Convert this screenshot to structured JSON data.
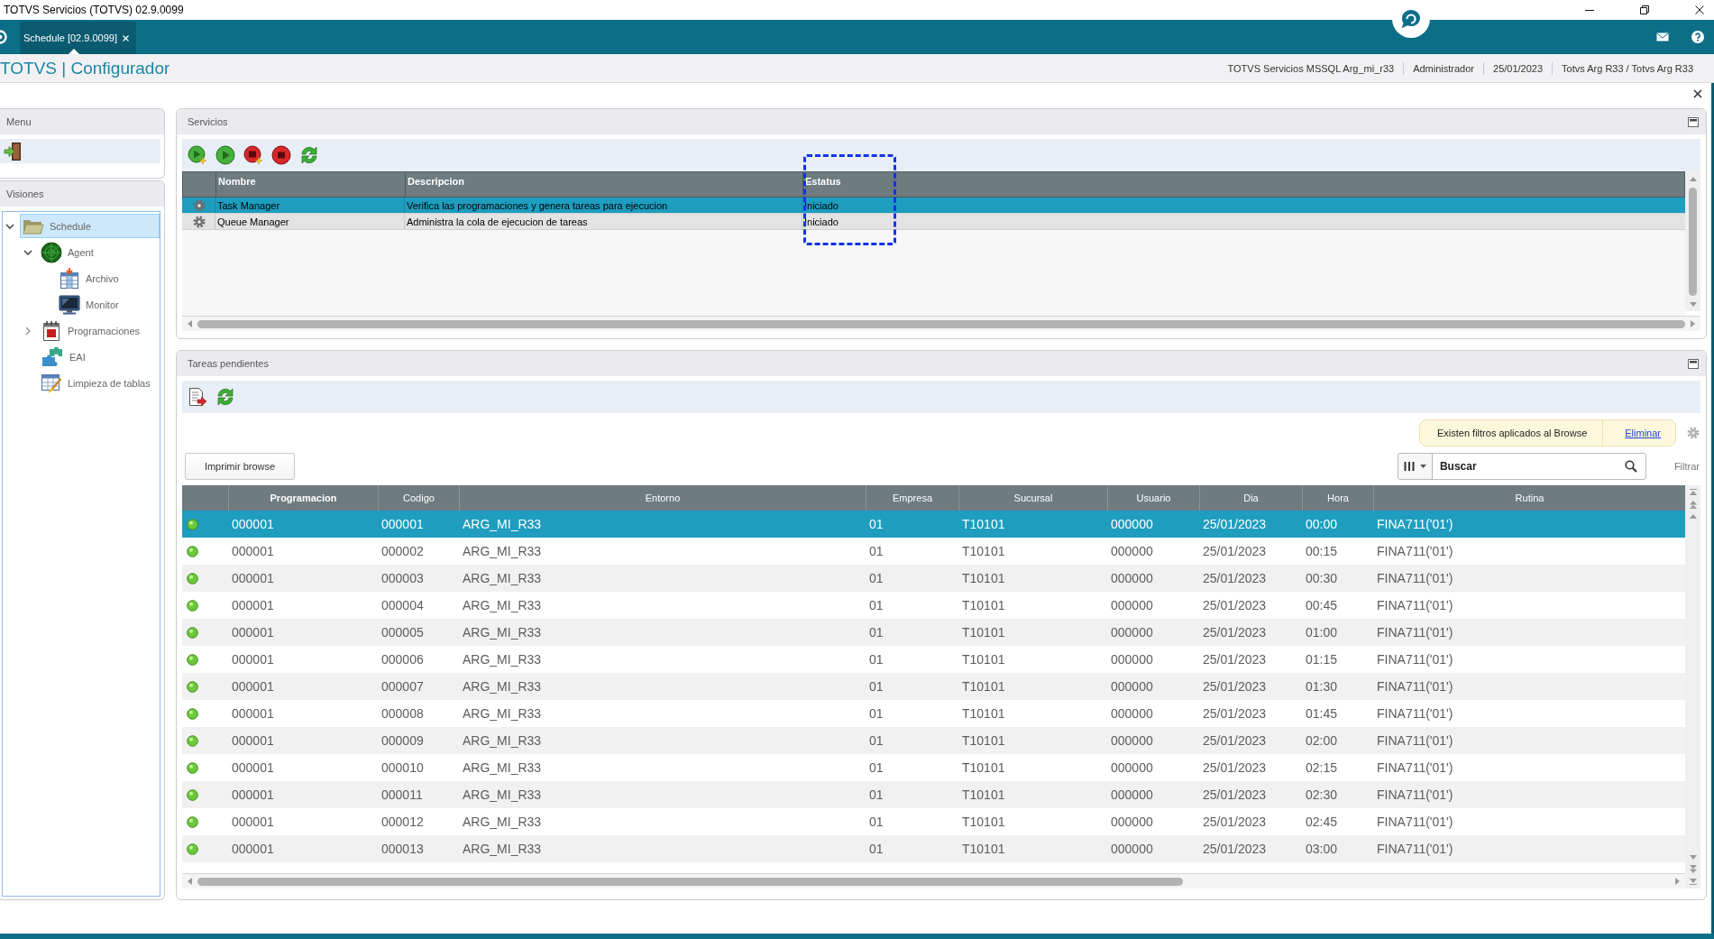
{
  "window": {
    "title": "TOTVS Servicios (TOTVS) 02.9.0099"
  },
  "tabs": [
    {
      "label": "Schedule [02.9.0099]",
      "selected": true
    }
  ],
  "header": {
    "title": "TOTVS | Configurador",
    "info": [
      "TOTVS Servicios MSSQL Arg_mi_r33",
      "Administrador",
      "25/01/2023",
      "Totvs Arg R33 / Totvs Arg R33"
    ]
  },
  "menu": {
    "title": "Menu"
  },
  "visiones": {
    "title": "Visiones",
    "tree": [
      {
        "label": "Schedule",
        "selected": true,
        "expanded": true,
        "children": [
          {
            "label": "Agent",
            "selected": false,
            "expanded": true,
            "children": [
              {
                "label": "Archivo",
                "selected": false
              },
              {
                "label": "Monitor",
                "selected": false
              }
            ]
          },
          {
            "label": "Programaciones",
            "selected": false,
            "expanded": false
          },
          {
            "label": "EAI",
            "selected": false
          },
          {
            "label": "Limpieza de tablas",
            "selected": false
          }
        ]
      }
    ]
  },
  "servicios": {
    "title": "Servicios",
    "columns": [
      {
        "label": "Nombre",
        "highlighted": false
      },
      {
        "label": "Descripcion",
        "highlighted": false
      },
      {
        "label": "Estatus",
        "highlighted": true
      }
    ],
    "rows": [
      {
        "cells": [
          "Task Manager",
          "Verifica las programaciones y genera tareas para ejecucion",
          "Iniciado"
        ],
        "selected": true
      },
      {
        "cells": [
          "Queue Manager",
          "Administra la cola de ejecucion de tareas",
          "Iniciado"
        ],
        "selected": false
      }
    ]
  },
  "tareas": {
    "title": "Tareas pendientes",
    "filter_notice": {
      "text": "Existen filtros aplicados al Browse",
      "link": "Eliminar"
    },
    "print_button": "Imprimir browse",
    "search": {
      "placeholder": "Buscar"
    },
    "filter_link": "Filtrar",
    "columns": [
      {
        "label": "Programacion",
        "sorted": true
      },
      {
        "label": "Codigo",
        "sorted": false
      },
      {
        "label": "Entorno",
        "sorted": false
      },
      {
        "label": "Empresa",
        "sorted": false
      },
      {
        "label": "Sucursal",
        "sorted": false
      },
      {
        "label": "Usuario",
        "sorted": false
      },
      {
        "label": "Dia",
        "sorted": false
      },
      {
        "label": "Hora",
        "sorted": false
      },
      {
        "label": "Rutina",
        "sorted": false
      }
    ],
    "rows": [
      {
        "cells": [
          "000001",
          "000001",
          "ARG_MI_R33",
          "01",
          "T10101",
          "000000",
          "25/01/2023",
          "00:00",
          "FINA711('01')"
        ],
        "selected": true
      },
      {
        "cells": [
          "000001",
          "000002",
          "ARG_MI_R33",
          "01",
          "T10101",
          "000000",
          "25/01/2023",
          "00:15",
          "FINA711('01')"
        ],
        "selected": false
      },
      {
        "cells": [
          "000001",
          "000003",
          "ARG_MI_R33",
          "01",
          "T10101",
          "000000",
          "25/01/2023",
          "00:30",
          "FINA711('01')"
        ],
        "selected": false
      },
      {
        "cells": [
          "000001",
          "000004",
          "ARG_MI_R33",
          "01",
          "T10101",
          "000000",
          "25/01/2023",
          "00:45",
          "FINA711('01')"
        ],
        "selected": false
      },
      {
        "cells": [
          "000001",
          "000005",
          "ARG_MI_R33",
          "01",
          "T10101",
          "000000",
          "25/01/2023",
          "01:00",
          "FINA711('01')"
        ],
        "selected": false
      },
      {
        "cells": [
          "000001",
          "000006",
          "ARG_MI_R33",
          "01",
          "T10101",
          "000000",
          "25/01/2023",
          "01:15",
          "FINA711('01')"
        ],
        "selected": false
      },
      {
        "cells": [
          "000001",
          "000007",
          "ARG_MI_R33",
          "01",
          "T10101",
          "000000",
          "25/01/2023",
          "01:30",
          "FINA711('01')"
        ],
        "selected": false
      },
      {
        "cells": [
          "000001",
          "000008",
          "ARG_MI_R33",
          "01",
          "T10101",
          "000000",
          "25/01/2023",
          "01:45",
          "FINA711('01')"
        ],
        "selected": false
      },
      {
        "cells": [
          "000001",
          "000009",
          "ARG_MI_R33",
          "01",
          "T10101",
          "000000",
          "25/01/2023",
          "02:00",
          "FINA711('01')"
        ],
        "selected": false
      },
      {
        "cells": [
          "000001",
          "000010",
          "ARG_MI_R33",
          "01",
          "T10101",
          "000000",
          "25/01/2023",
          "02:15",
          "FINA711('01')"
        ],
        "selected": false
      },
      {
        "cells": [
          "000001",
          "000011",
          "ARG_MI_R33",
          "01",
          "T10101",
          "000000",
          "25/01/2023",
          "02:30",
          "FINA711('01')"
        ],
        "selected": false
      },
      {
        "cells": [
          "000001",
          "000012",
          "ARG_MI_R33",
          "01",
          "T10101",
          "000000",
          "25/01/2023",
          "02:45",
          "FINA711('01')"
        ],
        "selected": false
      },
      {
        "cells": [
          "000001",
          "000013",
          "ARG_MI_R33",
          "01",
          "T10101",
          "000000",
          "25/01/2023",
          "03:00",
          "FINA711('01')"
        ],
        "selected": false
      }
    ]
  }
}
